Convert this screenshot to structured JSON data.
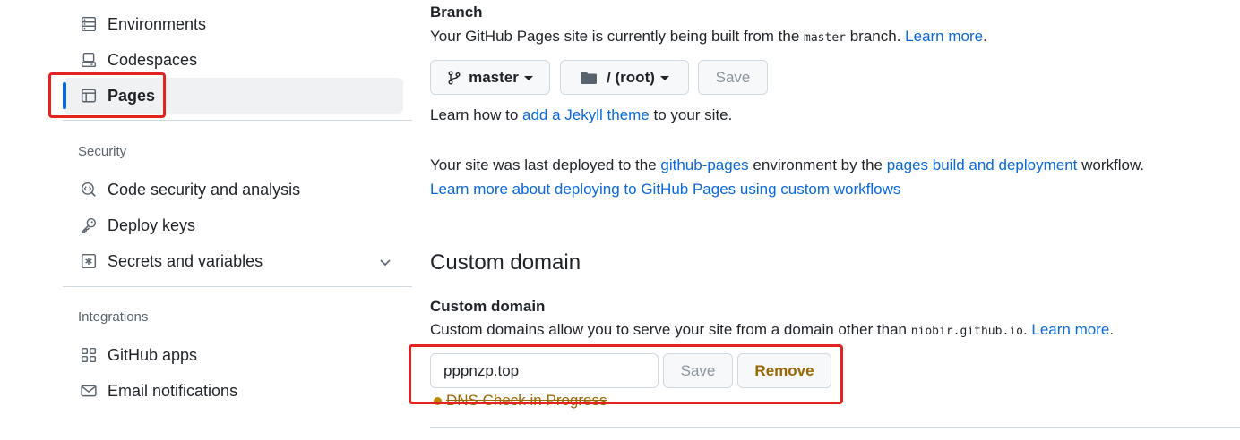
{
  "sidebar": {
    "items_top": [
      {
        "label": "Environments",
        "icon": "server-icon"
      },
      {
        "label": "Codespaces",
        "icon": "codespaces-icon"
      },
      {
        "label": "Pages",
        "icon": "browser-icon",
        "active": true
      }
    ],
    "security": {
      "title": "Security",
      "items": [
        {
          "label": "Code security and analysis",
          "icon": "codescan-icon"
        },
        {
          "label": "Deploy keys",
          "icon": "key-icon"
        },
        {
          "label": "Secrets and variables",
          "icon": "asterisk-icon",
          "expandable": true
        }
      ]
    },
    "integrations": {
      "title": "Integrations",
      "items": [
        {
          "label": "GitHub apps",
          "icon": "apps-icon"
        },
        {
          "label": "Email notifications",
          "icon": "mail-icon"
        }
      ]
    }
  },
  "branch": {
    "heading": "Branch",
    "desc_prefix": "Your GitHub Pages site is currently being built from the ",
    "branch_code": "master",
    "desc_suffix": " branch. ",
    "learn_more": "Learn more",
    "period": ".",
    "branch_button": "master",
    "folder_button": "/ (root)",
    "save_button": "Save",
    "jekyll_prefix": "Learn how to ",
    "jekyll_link": "add a Jekyll theme",
    "jekyll_suffix": " to your site."
  },
  "deploy": {
    "prefix": "Your site was last deployed to the ",
    "env_link": "github-pages",
    "middle": " environment by the ",
    "workflow_link": "pages build and deployment",
    "suffix": " workflow.",
    "custom_workflows_link": "Learn more about deploying to GitHub Pages using custom workflows"
  },
  "custom_domain": {
    "section_heading": "Custom domain",
    "label": "Custom domain",
    "desc_prefix": "Custom domains allow you to serve your site from a domain other than ",
    "domain_code": "niobir.github.io",
    "desc_suffix": ". ",
    "learn_more": "Learn more",
    "period": ".",
    "input_value": "pppnzp.top",
    "save_button": "Save",
    "remove_button": "Remove",
    "status_text": "DNS Check in Progress"
  },
  "colors": {
    "accent": "#0969da",
    "highlight": "#e3231f",
    "warning": "#9a6700"
  }
}
